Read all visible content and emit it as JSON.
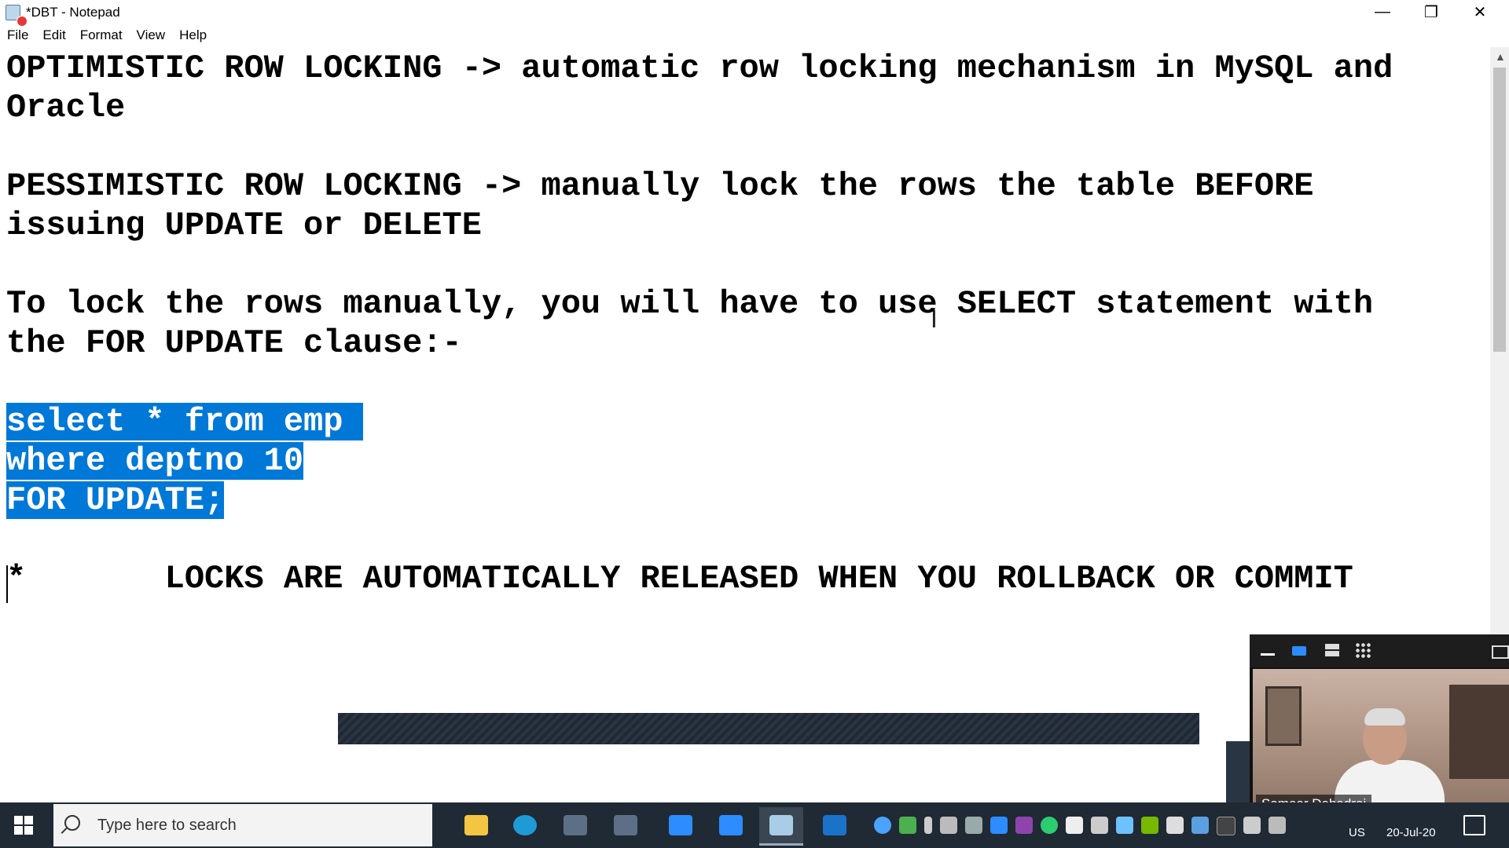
{
  "window": {
    "title": "*DBT - Notepad",
    "controls": {
      "minimize": "—",
      "maximize": "❐",
      "close": "✕"
    }
  },
  "menu": [
    "File",
    "Edit",
    "Format",
    "View",
    "Help"
  ],
  "document": {
    "lines": [
      "OPTIMISTIC ROW LOCKING -> automatic row locking mechanism in MySQL and",
      "Oracle",
      "",
      "PESSIMISTIC ROW LOCKING -> manually lock the rows the table BEFORE",
      "issuing UPDATE or DELETE",
      "",
      "To lock the rows manually, you will have to use SELECT statement with",
      "the FOR UPDATE clause:-",
      "",
      "select * from emp ",
      "where deptno 10",
      "FOR UPDATE;",
      "",
      "*       LOCKS ARE AUTOMATICALLY RELEASED WHEN YOU ROLLBACK OR COMMIT"
    ],
    "selected_lines": [
      9,
      10,
      11
    ],
    "selection_color": "#0078d7"
  },
  "video_panel": {
    "participant_name": "Sameer Dehadrai",
    "accent": "#2d8cff"
  },
  "taskbar": {
    "search_placeholder": "Type here to search",
    "language": "US",
    "date": "20-Jul-20",
    "apps": [
      "file-explorer",
      "edge",
      "sql-window-1",
      "sql-window-2",
      "zoom",
      "zoom-meeting",
      "notepad",
      "whiteboard"
    ]
  }
}
